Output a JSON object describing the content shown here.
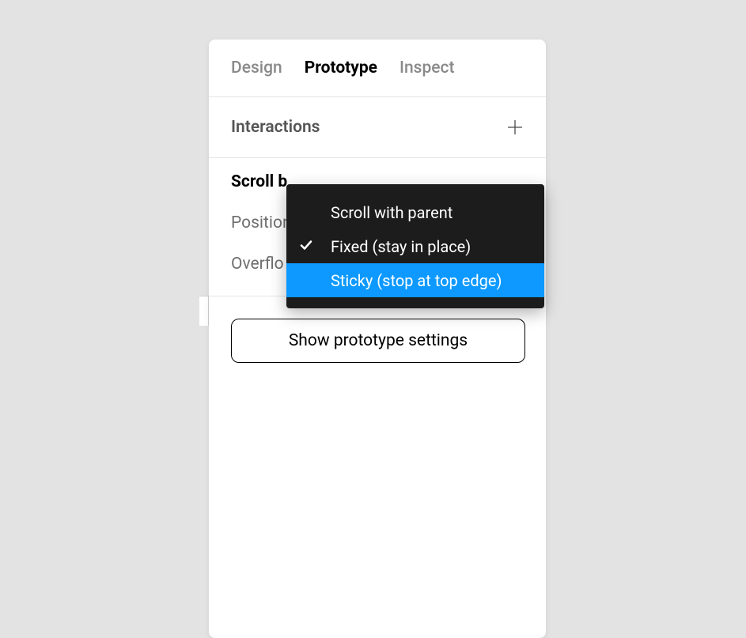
{
  "tabs": {
    "design": "Design",
    "prototype": "Prototype",
    "inspect": "Inspect"
  },
  "interactions": {
    "title": "Interactions"
  },
  "scroll": {
    "title": "Scroll b",
    "position_label": "Position",
    "overflow_label": "Overflo"
  },
  "dropdown": {
    "options": [
      "Scroll with parent",
      "Fixed (stay in place)",
      "Sticky (stop at top edge)"
    ],
    "selected_index": 1,
    "highlighted_index": 2
  },
  "footer": {
    "show_settings": "Show prototype settings"
  }
}
